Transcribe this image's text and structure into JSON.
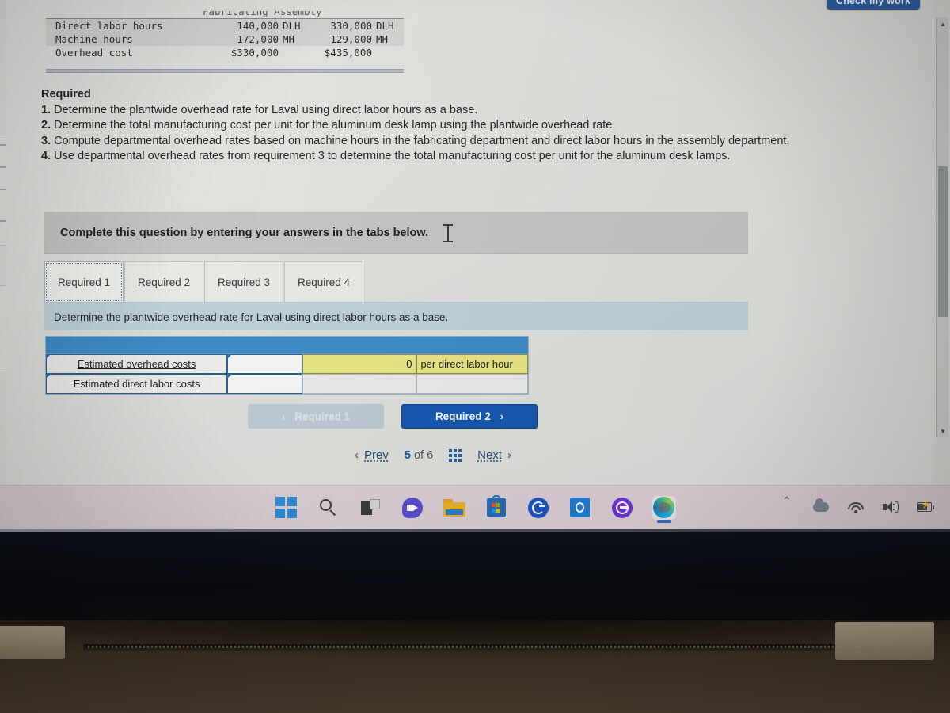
{
  "top_table": {
    "cut_header_note": "Fabricating   Assembly",
    "rows": [
      {
        "label": "Direct labor hours",
        "fabricating": "140,000",
        "fab_unit": "DLH",
        "assembly": "330,000",
        "asm_unit": "DLH"
      },
      {
        "label": "Machine hours",
        "fabricating": "172,000",
        "fab_unit": "MH",
        "assembly": "129,000",
        "asm_unit": "MH"
      },
      {
        "label": "Overhead cost",
        "fabricating": "$330,000",
        "fab_unit": "",
        "assembly": "$435,000",
        "asm_unit": ""
      }
    ]
  },
  "required": {
    "title": "Required",
    "items": [
      {
        "num": "1.",
        "text": "Determine the plantwide overhead rate for Laval using direct labor hours as a base."
      },
      {
        "num": "2.",
        "text": "Determine the total manufacturing cost per unit for the aluminum desk lamp using the plantwide overhead rate."
      },
      {
        "num": "3.",
        "text": "Compute departmental overhead rates based on machine hours in the fabricating department and direct labor hours in the assembly department."
      },
      {
        "num": "4.",
        "text": "Use departmental overhead rates from requirement 3 to determine the total manufacturing cost per unit for the aluminum desk lamps."
      }
    ]
  },
  "instruction_banner": {
    "text": "Complete this question by entering your answers in the tabs below."
  },
  "tabs": [
    {
      "label": "Required 1",
      "active": true
    },
    {
      "label": "Required 2",
      "active": false
    },
    {
      "label": "Required 3",
      "active": false
    },
    {
      "label": "Required 4",
      "active": false
    }
  ],
  "sub_banner": {
    "text": "Determine the plantwide overhead rate for Laval using direct labor hours as a base."
  },
  "answer_grid": {
    "rows": [
      {
        "label": "Estimated overhead costs",
        "underlined": true,
        "input": "",
        "amount": "0",
        "suffix": "per direct labor hour",
        "highlighted": true
      },
      {
        "label": "Estimated direct labor costs",
        "underlined": false,
        "input": "",
        "amount": "",
        "suffix": "",
        "highlighted": false
      }
    ]
  },
  "req_nav": {
    "prev_label": "Required 1",
    "prev_chevron": "‹",
    "next_label": "Required 2",
    "next_chevron": "›"
  },
  "pager": {
    "prev_label": "Prev",
    "prev_chevron": "‹",
    "current": "5",
    "of_label": "of",
    "total": "6",
    "next_label": "Next",
    "next_chevron": "›"
  },
  "check_work": {
    "label": "Check my work"
  },
  "taskbar": {
    "icons": [
      "windows-start-icon",
      "search-icon",
      "task-view-icon",
      "teams-chat-icon",
      "file-explorer-icon",
      "microsoft-store-icon",
      "cortana-icon",
      "outlook-icon",
      "purple-arrow-icon",
      "microsoft-edge-icon"
    ]
  },
  "tray": {
    "icons": [
      "show-hidden-icons-chevron",
      "onedrive-cloud-icon",
      "wifi-icon",
      "volume-icon",
      "battery-icon"
    ]
  },
  "colors": {
    "primary_blue": "#1559b5",
    "header_blue": "#3e8ecc",
    "highlight_yellow": "#eeeb86",
    "banner_gray": "#c7c8c6",
    "sub_banner_blue": "#c2d5dd"
  }
}
